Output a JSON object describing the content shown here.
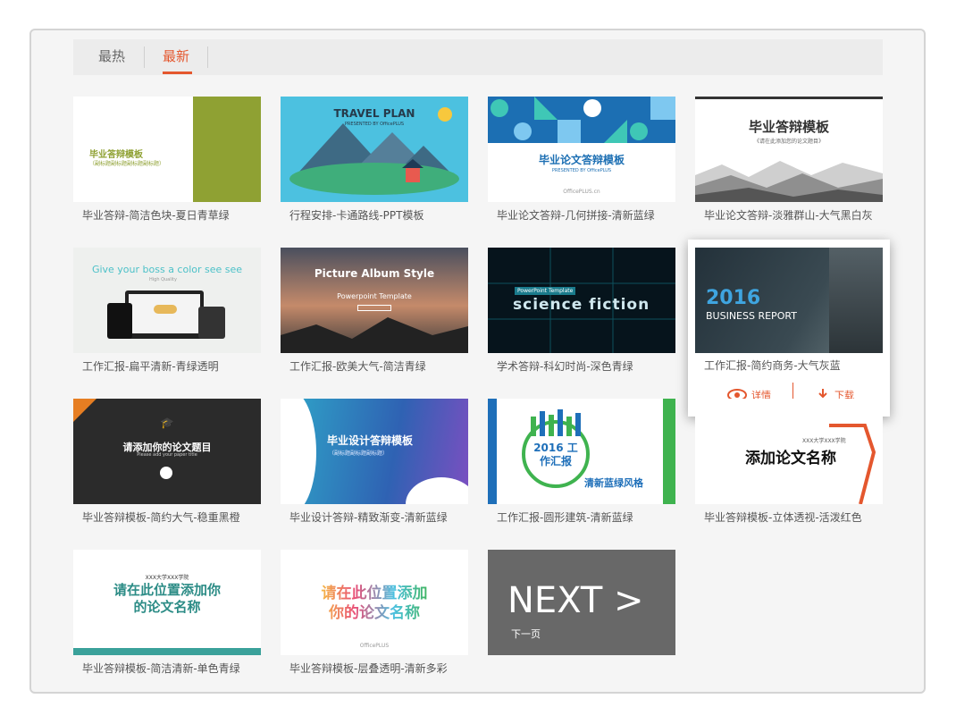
{
  "tabs": [
    {
      "label": "最热"
    },
    {
      "label": "最新"
    }
  ],
  "cards": [
    {
      "caption": "毕业答辩-简洁色块-夏日青草绿",
      "thumb_title": "毕业答辩模板",
      "thumb_sub": "（副标题副标题副标题副标题）"
    },
    {
      "caption": "行程安排-卡通路线-PPT模板",
      "thumb_title": "TRAVEL PLAN",
      "thumb_sub": "PRESENTED BY OfficePLUS"
    },
    {
      "caption": "毕业论文答辩-几何拼接-清新蓝绿",
      "thumb_title": "毕业论文答辩模板",
      "thumb_sub": "PRESENTED BY OfficePLUS"
    },
    {
      "caption": "毕业论文答辩-淡雅群山-大气黑白灰",
      "thumb_title": "毕业答辩模板",
      "thumb_sub": "《请在此添加您的论文题目》"
    },
    {
      "caption": "工作汇报-扁平清新-青绿透明",
      "thumb_title": "Give your boss a color see see",
      "thumb_sub": "High Quality"
    },
    {
      "caption": "工作汇报-欧美大气-简洁青绿",
      "thumb_title": "Picture Album Style",
      "thumb_sub": "Powerpoint Template"
    },
    {
      "caption": "学术答辩-科幻时尚-深色青绿",
      "thumb_title": "science fiction",
      "thumb_sub": "PowerPoint Template"
    },
    {
      "caption": "工作汇报-简约商务-大气灰蓝",
      "thumb_title": "2016",
      "thumb_sub": "BUSINESS REPORT"
    },
    {
      "caption": "毕业答辩模板-简约大气-稳重黑橙",
      "thumb_title": "请添加你的论文题目",
      "thumb_sub": "Please add your paper title"
    },
    {
      "caption": "毕业设计答辩-精致渐变-清新蓝绿",
      "thumb_title": "毕业设计答辩模板",
      "thumb_sub": "（副标题副标题副标题）"
    },
    {
      "caption": "工作汇报-圆形建筑-清新蓝绿",
      "thumb_title": "2016 工作汇报",
      "thumb_sub": "清新蓝绿风格"
    },
    {
      "caption": "毕业答辩模板-立体透视-活泼红色",
      "thumb_title": "添加论文名称",
      "thumb_sub": "XXX大学XXX学院"
    },
    {
      "caption": "毕业答辩模板-简洁清新-单色青绿",
      "thumb_title": "请在此位置添加你的论文名称",
      "thumb_sub": "XXX大学XXX学院"
    },
    {
      "caption": "毕业答辩模板-层叠透明-清新多彩",
      "thumb_title": "请在此位置添加你的论文名称",
      "thumb_sub": "OfficePLUS"
    }
  ],
  "hover_actions": {
    "detail": "详情",
    "download": "下载"
  },
  "next": {
    "label": "NEXT >",
    "sub": "下一页"
  },
  "watermark": "OfficePLUS.cn"
}
